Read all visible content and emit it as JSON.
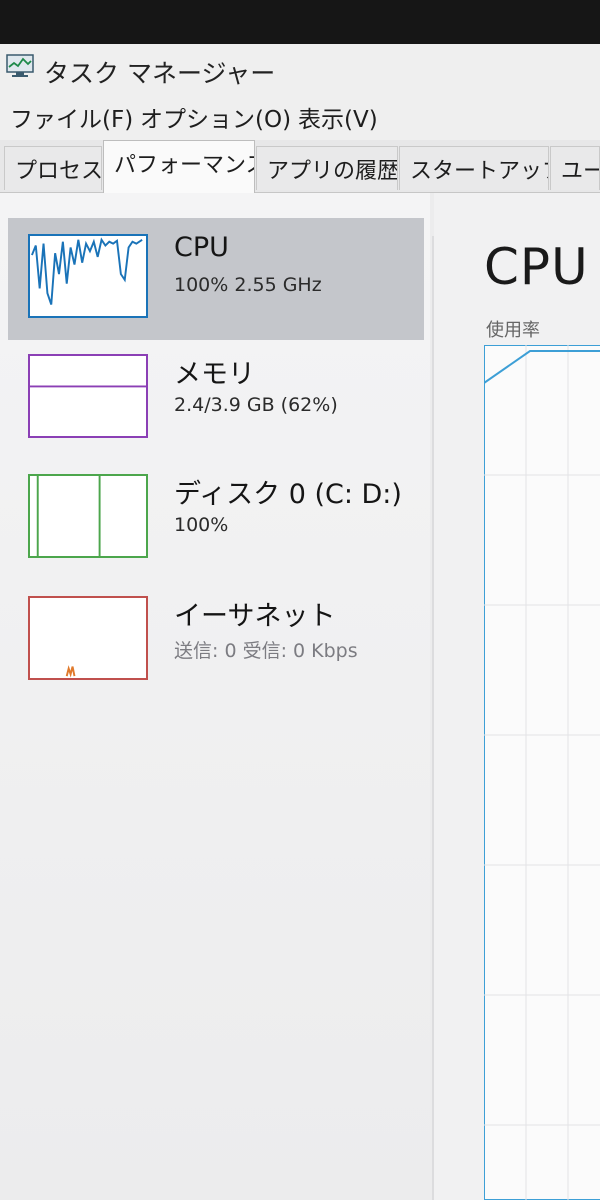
{
  "window": {
    "title": "タスク マネージャー",
    "icon": "task-manager-icon"
  },
  "menu": [
    "ファイル(F)",
    "オプション(O)",
    "表示(V)"
  ],
  "tabs": [
    {
      "label": "プロセス",
      "active": false
    },
    {
      "label": "パフォーマンス",
      "active": true
    },
    {
      "label": "アプリの履歴",
      "active": false
    },
    {
      "label": "スタートアップ",
      "active": false
    },
    {
      "label": "ユー",
      "active": false
    }
  ],
  "resources": [
    {
      "name": "CPU",
      "detail": "100%  2.55 GHz",
      "color": "#1a73b8",
      "selected": true
    },
    {
      "name": "メモリ",
      "detail": "2.4/3.9 GB (62%)",
      "color": "#8b3fb5",
      "selected": false
    },
    {
      "name": "ディスク 0 (C: D:)",
      "detail": "100%",
      "color": "#4ca64c",
      "selected": false
    },
    {
      "name": "イーサネット",
      "detail": "送信: 0 受信: 0 Kbps",
      "color": "#c0504d",
      "selected": false
    }
  ],
  "detail_panel": {
    "title": "CPU",
    "usage_label": "使用率",
    "graph_color": "#3d9fd6"
  }
}
